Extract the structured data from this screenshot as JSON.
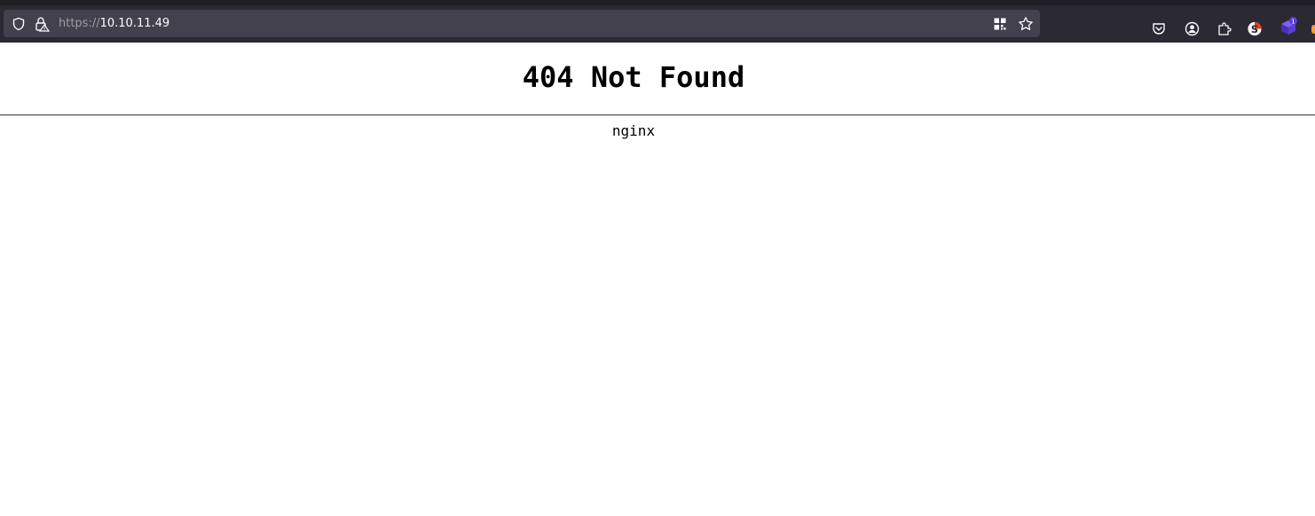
{
  "browser": {
    "url": {
      "scheme": "https://",
      "host": "10.10.11.49"
    },
    "toolbar_icons": [
      "pocket-icon",
      "account-icon",
      "extensions-icon",
      "extension-s-icon",
      "extension-cube-icon"
    ],
    "extension_badge": "1",
    "extension_s_letter": "S"
  },
  "page": {
    "title": "404 Not Found",
    "server": "nginx"
  },
  "colors": {
    "toolbar_bg": "#2b2a33",
    "urlbar_bg": "#42414d",
    "icon_fg": "#fbfbfe",
    "extension_cube": "#5b3fd4"
  }
}
